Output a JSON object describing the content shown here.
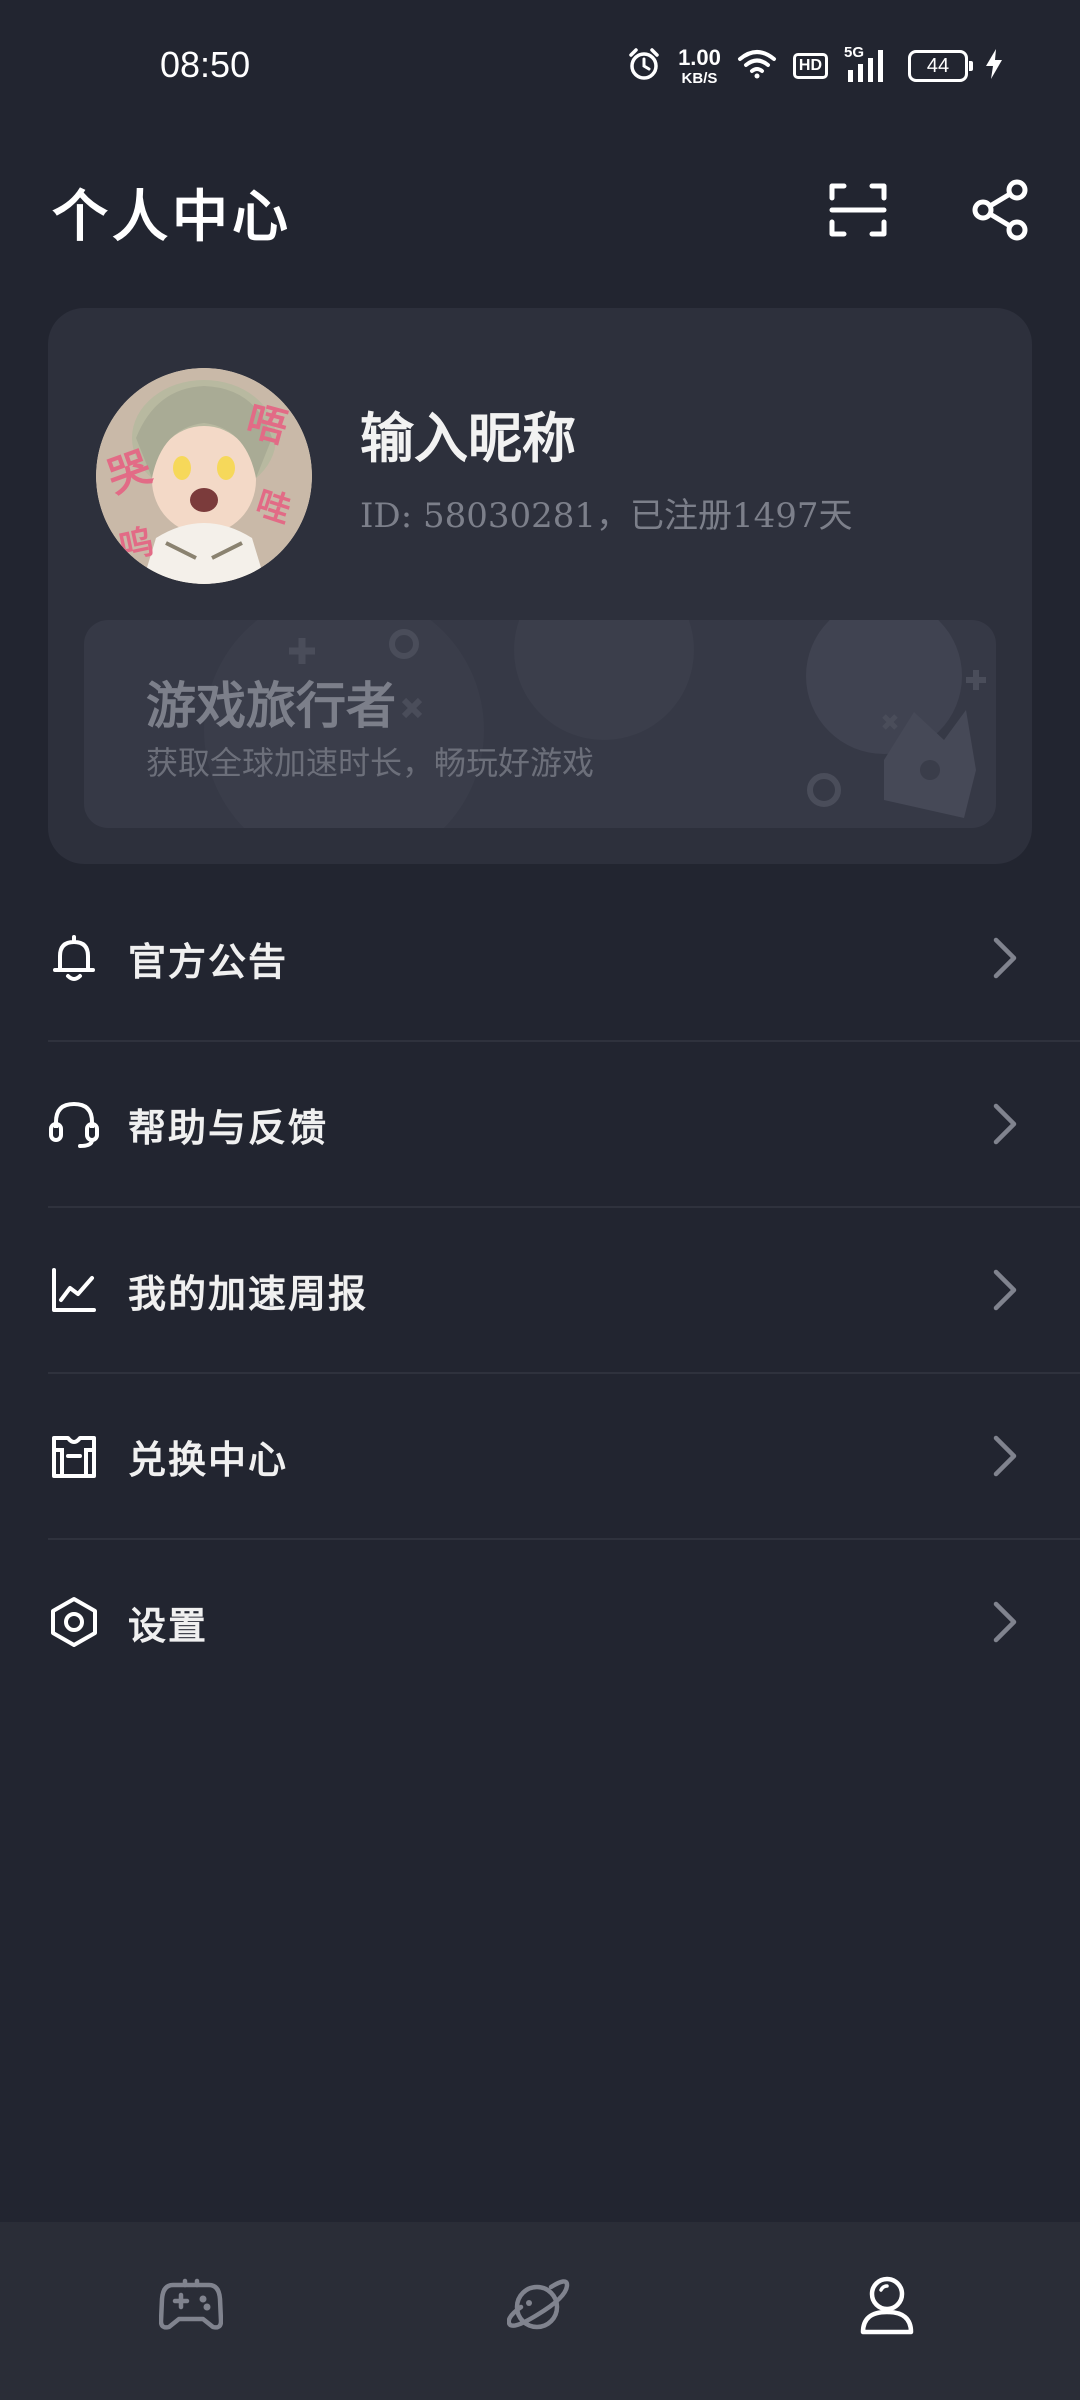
{
  "status_bar": {
    "time": "08:50",
    "net_speed_value": "1.00",
    "net_speed_unit": "KB/S",
    "hd_label": "HD",
    "network_label": "5G",
    "battery_level": "44",
    "icons": [
      "alarm-icon",
      "wifi-icon",
      "hd-icon",
      "signal-5g-icon",
      "battery-icon",
      "charging-icon"
    ]
  },
  "header": {
    "title": "个人中心",
    "scan_icon": "scan-icon",
    "share_icon": "share-icon"
  },
  "profile": {
    "nickname": "输入昵称",
    "id_text": "ID: 58030281，已注册1497天",
    "avatar_icon": "avatar-image"
  },
  "vip_banner": {
    "title": "游戏旅行者",
    "subtitle": "获取全球加速时长，畅玩好游戏"
  },
  "menu": {
    "items": [
      {
        "label": "官方公告",
        "icon": "bell-icon"
      },
      {
        "label": "帮助与反馈",
        "icon": "headset-icon"
      },
      {
        "label": "我的加速周报",
        "icon": "chart-icon"
      },
      {
        "label": "兑换中心",
        "icon": "shirt-icon"
      },
      {
        "label": "设置",
        "icon": "settings-hex-icon"
      }
    ]
  },
  "bottom_nav": {
    "items": [
      {
        "icon": "gamepad-icon",
        "active": false
      },
      {
        "icon": "planet-icon",
        "active": false
      },
      {
        "icon": "person-icon",
        "active": true
      }
    ]
  },
  "colors": {
    "background": "#222530",
    "card": "#2d303c",
    "banner": "#363946",
    "muted_text": "#7c7f8a",
    "divider": "#2f323d",
    "nav_bg": "#2a2d37"
  }
}
